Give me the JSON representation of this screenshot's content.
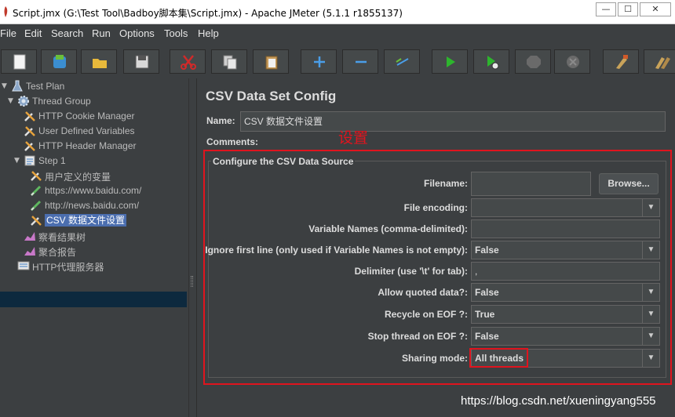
{
  "window": {
    "title": "Script.jmx (G:\\Test Tool\\Badboy脚本集\\Script.jmx) - Apache JMeter (5.1.1 r1855137)",
    "buttons": {
      "minimize": "—",
      "maximize": "☐",
      "close": "✕"
    }
  },
  "menu": [
    "File",
    "Edit",
    "Search",
    "Run",
    "Options",
    "Tools",
    "Help"
  ],
  "toolbar": {
    "icons": [
      "new-icon",
      "templates-icon",
      "open-icon",
      "save-icon",
      "cut-icon",
      "copy-icon",
      "paste-icon",
      "expand-icon",
      "collapse-icon",
      "toggle-icon",
      "start-icon",
      "start-no-pauses-icon",
      "stop-icon",
      "shutdown-icon",
      "clear-icon",
      "clear-all-icon"
    ]
  },
  "tree": {
    "nodes": [
      {
        "label": "Test Plan",
        "icon": "test-plan-icon"
      },
      {
        "label": "Thread Group",
        "icon": "thread-group-icon"
      },
      {
        "label": "HTTP Cookie Manager",
        "icon": "config-element-icon"
      },
      {
        "label": "User Defined Variables",
        "icon": "config-element-icon"
      },
      {
        "label": "HTTP Header Manager",
        "icon": "config-element-icon"
      },
      {
        "label": "Step 1",
        "icon": "transaction-controller-icon"
      },
      {
        "label": "用户定义的变量",
        "icon": "config-element-icon"
      },
      {
        "label": "https://www.baidu.com/",
        "icon": "http-sampler-icon"
      },
      {
        "label": "http://news.baidu.com/",
        "icon": "http-sampler-icon"
      },
      {
        "label": "CSV 数据文件设置",
        "icon": "config-element-icon"
      },
      {
        "label": "察看结果树",
        "icon": "listener-icon"
      },
      {
        "label": "聚合报告",
        "icon": "listener-icon"
      },
      {
        "label": "HTTP代理服务器",
        "icon": "proxy-server-icon"
      }
    ]
  },
  "panel": {
    "title": "CSV Data Set Config",
    "name_label": "Name:",
    "name_value": "CSV 数据文件设置",
    "comments_label": "Comments:",
    "annotation": "设置",
    "group_title": "Configure the CSV Data Source",
    "filename_label": "Filename:",
    "filename_value": "",
    "browse_label": "Browse...",
    "encoding_label": "File encoding:",
    "encoding_value": "",
    "varnames_label": "Variable Names (comma-delimited):",
    "varnames_value": "",
    "ignore_label": "Ignore first line (only used if Variable Names is not empty):",
    "ignore_value": "False",
    "delimiter_label": "Delimiter (use '\\t' for tab):",
    "delimiter_value": ",",
    "quoted_label": "Allow quoted data?:",
    "quoted_value": "False",
    "recycle_label": "Recycle on EOF ?:",
    "recycle_value": "True",
    "stopthread_label": "Stop thread on EOF ?:",
    "stopthread_value": "False",
    "sharing_label": "Sharing mode:",
    "sharing_value": "All threads"
  },
  "watermark": "https://blog.csdn.net/xueningyang555",
  "colors": {
    "background": "#3c3f41",
    "selection": "#4b6eaf",
    "annotation": "#e0141e"
  }
}
